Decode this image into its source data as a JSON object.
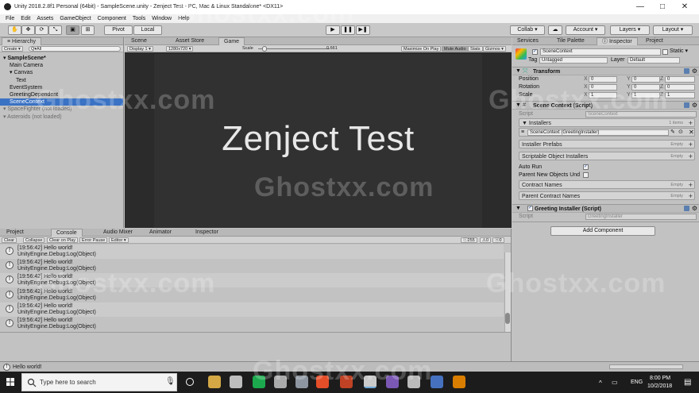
{
  "window": {
    "title": "Unity 2018.2.8f1 Personal (64bit) - SampleScene.unity - Zenject Test - PC, Mac & Linux Standalone* <DX11>",
    "minimize_glyph": "—",
    "maximize_glyph": "□",
    "close_glyph": "✕"
  },
  "menu": [
    "File",
    "Edit",
    "Assets",
    "GameObject",
    "Component",
    "Tools",
    "Window",
    "Help"
  ],
  "toolbar": {
    "tools": [
      "✋",
      "✥",
      "⟳",
      "⤡",
      "▣",
      "⊞"
    ],
    "pivot": "Pivot",
    "local": "Local",
    "play": "▶",
    "pause": "❚❚",
    "step": "▶❚",
    "collab": "Collab ▾",
    "account": "Account ▾",
    "layers": "Layers ▾",
    "layout": "Layout ▾"
  },
  "hierarchy": {
    "tab": "Hierarchy",
    "create": "Create ▾",
    "search_glyph": "Q▾All",
    "items": [
      {
        "label": "SampleScene*",
        "indent": 0,
        "state": "normal"
      },
      {
        "label": "Main Camera",
        "indent": 1,
        "state": "normal"
      },
      {
        "label": "Canvas",
        "indent": 1,
        "state": "normal"
      },
      {
        "label": "Text",
        "indent": 2,
        "state": "normal"
      },
      {
        "label": "EventSystem",
        "indent": 1,
        "state": "normal"
      },
      {
        "label": "GreetingDependent",
        "indent": 1,
        "state": "normal"
      },
      {
        "label": "SceneContext",
        "indent": 1,
        "state": "selected"
      },
      {
        "label": "SpaceFighter (not loaded)",
        "indent": 0,
        "state": "dim"
      },
      {
        "label": "Asteroids (not loaded)",
        "indent": 0,
        "state": "dim"
      }
    ]
  },
  "views": {
    "tabs": [
      "Scene",
      "Asset Store",
      "Game"
    ],
    "display": "Display 1 ▾",
    "resolution": "1280x720 ▾",
    "scale_label": "Scale",
    "scale_value": "0.661",
    "scale_fraction": 0.05,
    "options": [
      "Maximize On Play",
      "Mute Audio",
      "Stats",
      "Gizmos ▾"
    ],
    "game_text": "Zenject Test"
  },
  "console": {
    "tabs": [
      "Project",
      "Console",
      "Audio Mixer",
      "Animator",
      "Inspector"
    ],
    "buttons": [
      "Clear",
      "Collapse",
      "Clear on Play",
      "Error Pause",
      "Editor ▾"
    ],
    "count_label": "255",
    "count_a": "0",
    "count_b": "0",
    "entries": [
      {
        "line1": "[19:56:42] Hello world!",
        "line2": "UnityEngine.Debug:Log(Object)"
      },
      {
        "line1": "[19:56:42] Hello world!",
        "line2": "UnityEngine.Debug:Log(Object)"
      },
      {
        "line1": "[19:56:42] Hello world!",
        "line2": "UnityEngine.Debug:Log(Object)"
      },
      {
        "line1": "[19:56:42] Hello world!",
        "line2": "UnityEngine.Debug:Log(Object)"
      },
      {
        "line1": "[19:56:42] Hello world!",
        "line2": "UnityEngine.Debug:Log(Object)"
      },
      {
        "line1": "[19:56:42] Hello world!",
        "line2": "UnityEngine.Debug:Log(Object)"
      }
    ]
  },
  "inspector": {
    "tabs": [
      "Services",
      "Tile Palette",
      "Inspector",
      "Project"
    ],
    "object_name": "SceneContext",
    "static_label": "Static ▾",
    "tag_label": "Tag",
    "tag_value": "Untagged",
    "layer_label": "Layer",
    "layer_value": "Default",
    "transform": {
      "title": "Transform",
      "rows": [
        {
          "label": "Position",
          "x": "0",
          "y": "0",
          "z": "0"
        },
        {
          "label": "Rotation",
          "x": "0",
          "y": "0",
          "z": "0"
        },
        {
          "label": "Scale",
          "x": "1",
          "y": "1",
          "z": "1"
        }
      ]
    },
    "scene_context": {
      "title": "Scene Context (Script)",
      "script_label": "Script",
      "script_value": "SceneContext",
      "installers_label": "▼ Installers",
      "installers_count": "1 items",
      "installer_item": "SceneContext (GreetingInstaller)",
      "installer_prefabs": "Installer Prefabs",
      "scriptable_installers": "Scriptable Object Installers",
      "auto_run": "Auto Run",
      "parent_new_objects": "Parent New Objects Und",
      "contract_names": "Contract Names",
      "parent_contract_names": "Parent Contract Names",
      "empty": "Empty"
    },
    "greeting": {
      "title": "Greeting Installer (Script)",
      "script_label": "Script",
      "script_value": "GreetingInstaller"
    },
    "add_component": "Add Component"
  },
  "status": {
    "message": "Hello world!"
  },
  "taskbar": {
    "search": "Type here to search",
    "lang": "ENG",
    "time": "8:00 PM",
    "date": "10/2/2018",
    "icons": [
      "cortana-icon",
      "task-view-icon",
      "file-explorer-icon",
      "obs-icon",
      "spotify-icon",
      "photos-icon",
      "unity-hub-icon",
      "brave-icon",
      "powerpoint-icon",
      "unity-icon",
      "visual-studio-icon",
      "defender-icon",
      "app-icon",
      "vlc-icon"
    ]
  },
  "watermark": "Ghostxx.com",
  "colors": {
    "accent": "#3a72c4",
    "game_bg": "#313131",
    "taskbar": "#1c1c1c"
  }
}
